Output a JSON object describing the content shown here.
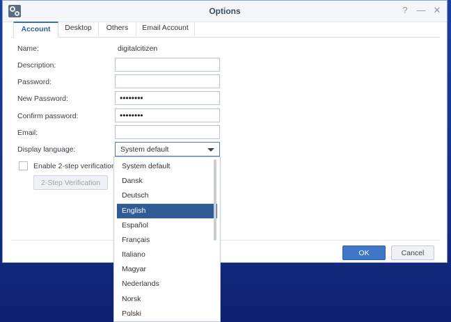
{
  "window": {
    "title": "Options"
  },
  "titlebar": {
    "help": "?",
    "minimize": "—",
    "close": "✕"
  },
  "tabs": [
    {
      "label": "Account",
      "active": true
    },
    {
      "label": "Desktop",
      "active": false
    },
    {
      "label": "Others",
      "active": false
    },
    {
      "label": "Email Account",
      "active": false
    }
  ],
  "form": {
    "name_label": "Name:",
    "name_value": "digitalcitizen",
    "description_label": "Description:",
    "description_value": "",
    "password_label": "Password:",
    "password_value": "",
    "new_password_label": "New Password:",
    "new_password_value": "••••••••",
    "confirm_password_label": "Confirm password:",
    "confirm_password_value": "••••••••",
    "email_label": "Email:",
    "email_value": "",
    "display_language_label": "Display language:",
    "display_language_value": "System default",
    "two_step_label": "Enable 2-step verification",
    "two_step_checked": false,
    "two_step_button": "2-Step Verification"
  },
  "footer": {
    "ok": "OK",
    "cancel": "Cancel"
  },
  "dropdown": {
    "options": [
      "System default",
      "Dansk",
      "Deutsch",
      "English",
      "Español",
      "Français",
      "Italiano",
      "Magyar",
      "Nederlands",
      "Norsk",
      "Polski"
    ],
    "highlighted": "English"
  },
  "colors": {
    "accent": "#3f77c6",
    "selected": "#2f5c97",
    "desktop": "#1b3f9e"
  }
}
